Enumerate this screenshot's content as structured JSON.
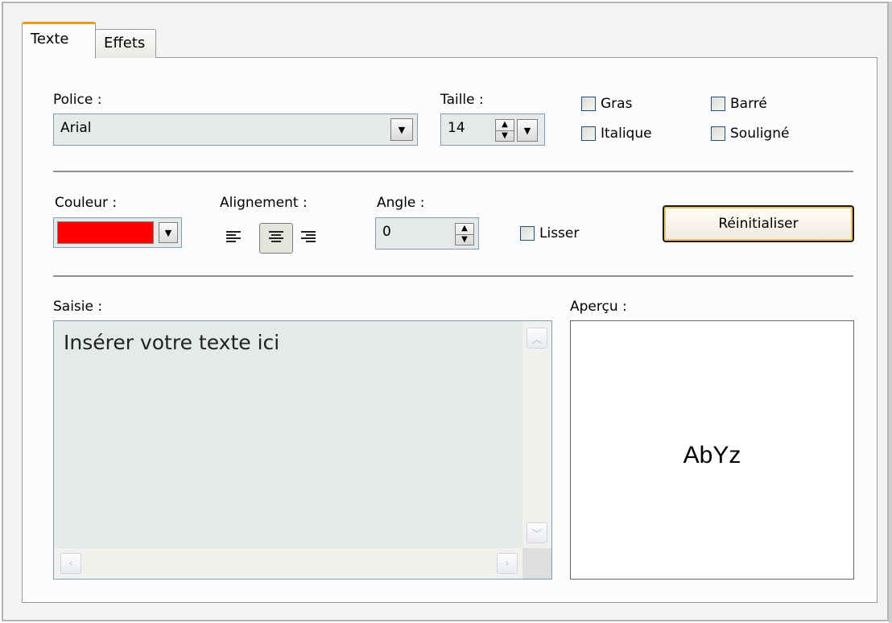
{
  "tabs": {
    "texte": "Texte",
    "effets": "Effets"
  },
  "font": {
    "label": "Police :",
    "value": "Arial"
  },
  "size": {
    "label": "Taille :",
    "value": "14"
  },
  "styles": {
    "gras": "Gras",
    "italique": "Italique",
    "barre": "Barré",
    "souligne": "Souligné"
  },
  "color": {
    "label": "Couleur :",
    "value": "#ff0000"
  },
  "alignment": {
    "label": "Alignement :",
    "options": [
      "left",
      "center",
      "right"
    ],
    "selected": "center"
  },
  "angle": {
    "label": "Angle :",
    "value": "0"
  },
  "smooth": {
    "label": "Lisser"
  },
  "reset_label": "Réinitialiser",
  "input": {
    "label": "Saisie :",
    "text": "Insérer votre texte ici"
  },
  "preview": {
    "label": "Aperçu :",
    "sample": "AbYz"
  },
  "icons": [
    "chevron-down-icon",
    "spin-up-icon",
    "spin-down-icon",
    "align-left-icon",
    "align-center-icon",
    "align-right-icon",
    "scroll-up-icon",
    "scroll-down-icon",
    "scroll-left-icon",
    "scroll-right-icon"
  ]
}
